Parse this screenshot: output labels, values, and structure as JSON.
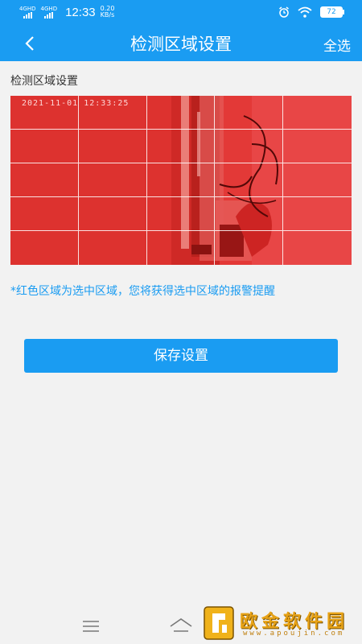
{
  "status_bar": {
    "sim1_label": "4GHD",
    "sim2_label": "4GHD",
    "time": "12:33",
    "speed_value": "0.20",
    "speed_unit": "KB/s",
    "battery": "72",
    "icons": [
      "alarm-icon",
      "wifi-icon",
      "battery-icon"
    ]
  },
  "nav": {
    "title": "检测区域设置",
    "select_all": "全选",
    "back_icon": "chevron-left-icon"
  },
  "section_label": "检测区域设置",
  "camera": {
    "timestamp": "2021-11-01  12:33:25",
    "grid_rows": 5,
    "grid_cols": 5,
    "all_selected": true,
    "selection_color": "#ff0000"
  },
  "hint": "*红色区域为选中区域，您将获得选中区域的报警提醒",
  "save_button": "保存设置",
  "bottom_nav": {
    "icons": [
      "menu-icon",
      "home-icon"
    ]
  },
  "watermark": {
    "name": "欧金软件园",
    "url": "www.apoujin.com"
  },
  "colors": {
    "primary": "#1a9cf2",
    "background": "#f2f2f2",
    "hint": "#1a9cf2"
  }
}
